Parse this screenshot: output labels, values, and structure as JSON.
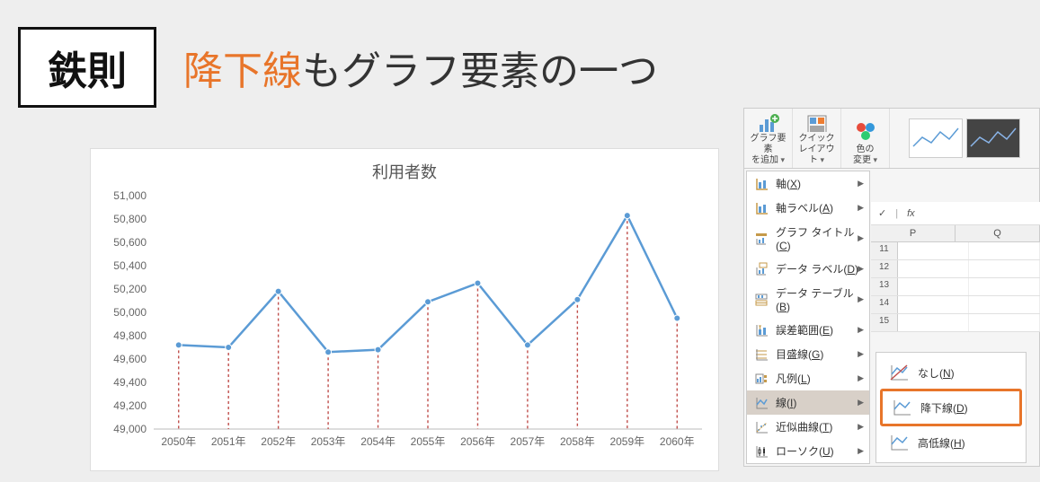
{
  "header": {
    "badge": "鉄則",
    "title_accent": "降下線",
    "title_rest": "もグラフ要素の一つ"
  },
  "chart_data": {
    "type": "line",
    "title": "利用者数",
    "categories": [
      "2050年",
      "2051年",
      "2052年",
      "2053年",
      "2054年",
      "2055年",
      "2056年",
      "2057年",
      "2058年",
      "2059年",
      "2060年"
    ],
    "values": [
      49720,
      49700,
      50180,
      49660,
      49680,
      50090,
      50250,
      49720,
      50110,
      50830,
      49950
    ],
    "ylabel": "",
    "xlabel": "",
    "ylim": [
      49000,
      51000
    ],
    "yticks": [
      49000,
      49200,
      49400,
      49600,
      49800,
      50000,
      50200,
      50400,
      50600,
      50800,
      51000
    ],
    "drop_lines": true,
    "line_color": "#5b9bd5",
    "drop_color": "#c0504d"
  },
  "ribbon": {
    "buttons": [
      {
        "label_l1": "グラフ要素",
        "label_l2": "を追加"
      },
      {
        "label_l1": "クイック",
        "label_l2": "レイアウト"
      },
      {
        "label_l1": "色の",
        "label_l2": "変更"
      }
    ],
    "menu": [
      {
        "icon": "axis",
        "label": "軸",
        "key": "X"
      },
      {
        "icon": "axis",
        "label": "軸ラベル",
        "key": "A"
      },
      {
        "icon": "title",
        "label": "グラフ タイトル",
        "key": "C"
      },
      {
        "icon": "label",
        "label": "データ ラベル",
        "key": "D"
      },
      {
        "icon": "table",
        "label": "データ テーブル",
        "key": "B"
      },
      {
        "icon": "error",
        "label": "誤差範囲",
        "key": "E"
      },
      {
        "icon": "grid",
        "label": "目盛線",
        "key": "G"
      },
      {
        "icon": "legend",
        "label": "凡例",
        "key": "L"
      },
      {
        "icon": "line",
        "label": "線",
        "key": "I",
        "selected": true
      },
      {
        "icon": "trend",
        "label": "近似曲線",
        "key": "T"
      },
      {
        "icon": "candle",
        "label": "ローソク",
        "key": "U"
      }
    ],
    "submenu": [
      {
        "label": "なし",
        "key": "N"
      },
      {
        "label": "降下線",
        "key": "D",
        "highlight": true
      },
      {
        "label": "高低線",
        "key": "H"
      }
    ]
  },
  "sheet": {
    "fx_check": "✓",
    "fx_label": "fx",
    "columns": [
      "P",
      "Q"
    ],
    "rows": [
      "11",
      "12",
      "13",
      "14",
      "15"
    ]
  }
}
